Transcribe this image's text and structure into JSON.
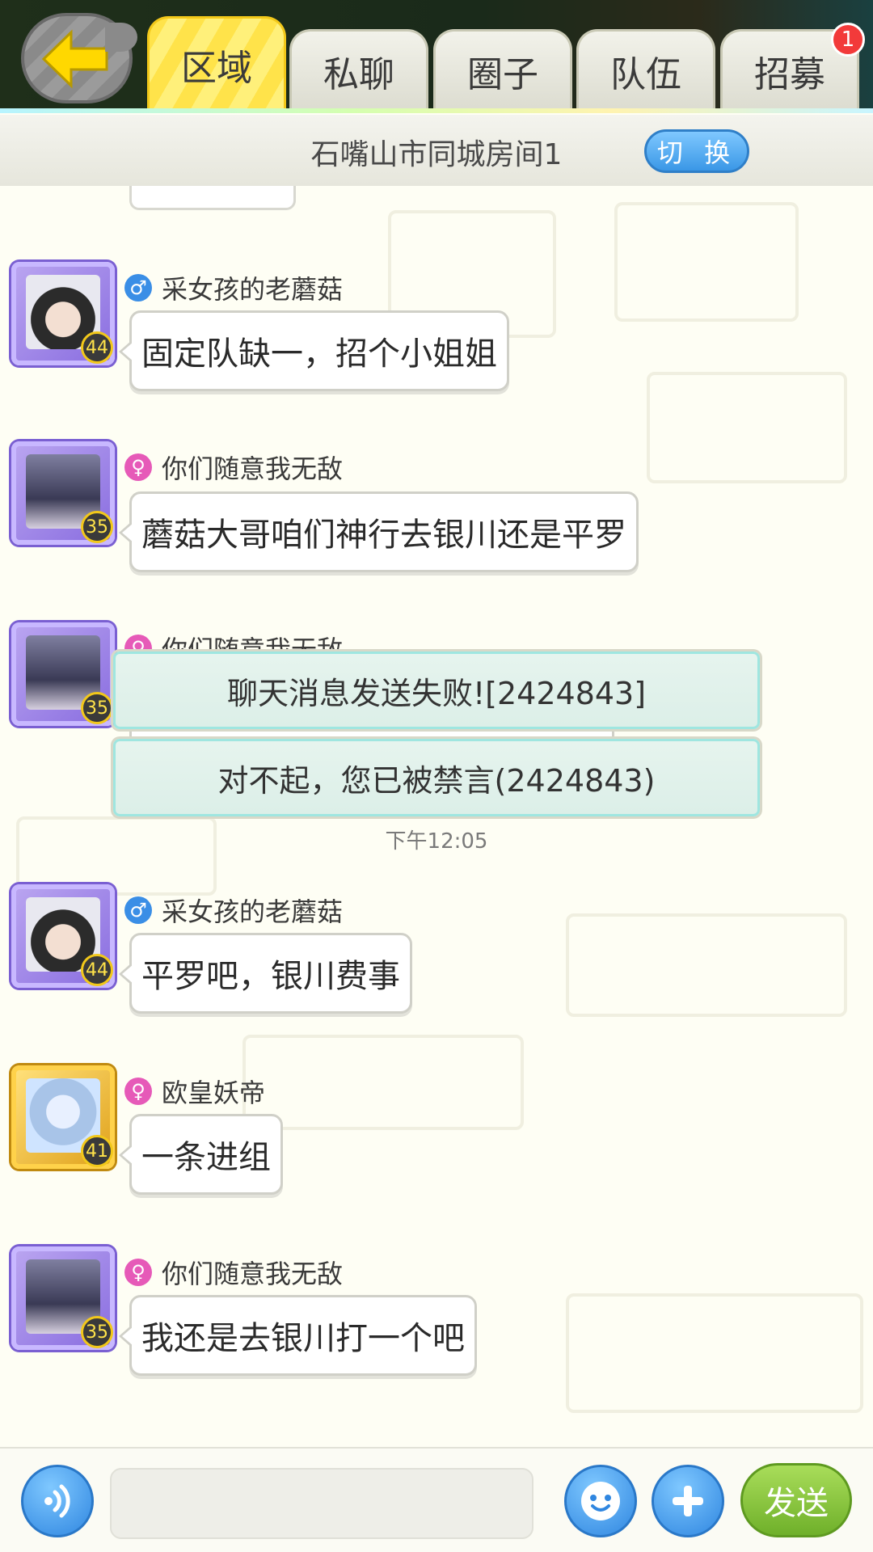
{
  "tabs": [
    {
      "label": "区域",
      "active": true
    },
    {
      "label": "私聊",
      "active": false
    },
    {
      "label": "圈子",
      "active": false
    },
    {
      "label": "队伍",
      "active": false
    },
    {
      "label": "招募",
      "active": false,
      "badge": "1"
    }
  ],
  "room": {
    "title": "石嘴山市同城房间1",
    "switch_label": "切 换"
  },
  "messages": [
    {
      "user": "采女孩的老蘑菇",
      "gender": "male",
      "level": "44",
      "avatar": "boy-avatar",
      "frame": "purple",
      "text": "固定队缺一，招个小姐姐"
    },
    {
      "user": "你们随意我无敌",
      "gender": "female",
      "level": "35",
      "avatar": "girl-avatar",
      "frame": "purple",
      "text": "蘑菇大哥咱们神行去银川还是平罗"
    },
    {
      "user": "你们随意我无敌",
      "gender": "female",
      "level": "35",
      "avatar": "girl-avatar",
      "frame": "purple",
      "text": ""
    },
    {
      "user": "采女孩的老蘑菇",
      "gender": "male",
      "level": "44",
      "avatar": "boy-avatar",
      "frame": "purple",
      "text": "平罗吧，银川费事"
    },
    {
      "user": "欧皇妖帝",
      "gender": "female",
      "level": "41",
      "avatar": "white-hair-avatar",
      "frame": "gold",
      "text": "一条进组"
    },
    {
      "user": "你们随意我无敌",
      "gender": "female",
      "level": "35",
      "avatar": "girl-avatar",
      "frame": "purple",
      "text": "我还是去银川打一个吧"
    }
  ],
  "toasts": [
    "聊天消息发送失败![2424843]",
    "对不起，您已被禁言(2424843)"
  ],
  "timestamp": "下午12:05",
  "input": {
    "value": "",
    "placeholder": "",
    "send_label": "发送"
  },
  "colors": {
    "active_tab": "#ffe34a",
    "male": "#3a8ee6",
    "female": "#e65ab8",
    "send": "#7cc034",
    "action_blue": "#3a97e6"
  }
}
